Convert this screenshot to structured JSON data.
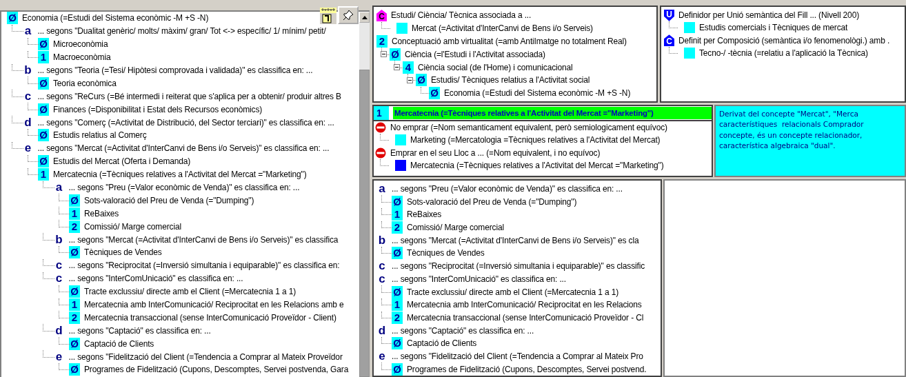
{
  "main_tree": {
    "nodes": [
      {
        "kind": "number",
        "badge": "Ø",
        "text": "Economia (=Estudi del Sistema econòmic -M +S -N)",
        "children": [
          {
            "kind": "letter",
            "badge": "a",
            "text": "... segons \"Dualitat genèric/ molts/ màxim/ gran/ Tot <-> específic/ 1/ mínim/ petit/",
            "children": [
              {
                "kind": "number",
                "badge": "Ø",
                "text": "Microeconòmia"
              },
              {
                "kind": "number",
                "badge": "1",
                "text": "Macroeconòmia"
              }
            ]
          },
          {
            "kind": "letter",
            "badge": "b",
            "text": "... segons \"Teoria (=Tesi/ Hipòtesi comprovada i validada)\" es classifica en: ...",
            "children": [
              {
                "kind": "number",
                "badge": "Ø",
                "text": "Teoria econòmica"
              }
            ]
          },
          {
            "kind": "letter",
            "badge": "c",
            "text": "... segons \"ReCurs (=Bé intermedi i reiterat que s'aplica per a obtenir/ produir altres B",
            "children": [
              {
                "kind": "number",
                "badge": "Ø",
                "text": "Finances (=Disponibilitat i Estat dels Recursos econòmics)"
              }
            ]
          },
          {
            "kind": "letter",
            "badge": "d",
            "text": "... segons \"Comerç (=Activitat de Distribució, del Sector terciari)\" es classifica en: ...",
            "children": [
              {
                "kind": "number",
                "badge": "Ø",
                "text": "Estudis relatius al Comerç"
              }
            ]
          },
          {
            "kind": "letter",
            "badge": "e",
            "text": "... segons \"Mercat (=Activitat d'InterCanvi de Bens i/o Serveis)\" es classifica en: ...",
            "children": [
              {
                "kind": "number",
                "badge": "Ø",
                "text": "Estudis del Mercat (Oferta i Demanda)"
              },
              {
                "kind": "number",
                "badge": "1",
                "text": "Mercatecnia (=Tècniques relatives a l'Activitat del Mercat =\"Marketing\")",
                "children": [
                  {
                    "kind": "letter",
                    "badge": "a",
                    "text": "... segons \"Preu (=Valor econòmic de Venda)\" es classifica en: ...",
                    "children": [
                      {
                        "kind": "number",
                        "badge": "Ø",
                        "text": "Sots-valoració del Preu de Venda (=\"Dumping\")"
                      },
                      {
                        "kind": "number",
                        "badge": "1",
                        "text": "ReBaixes"
                      },
                      {
                        "kind": "number",
                        "badge": "2",
                        "text": "Comissió/ Marge comercial"
                      }
                    ]
                  },
                  {
                    "kind": "letter",
                    "badge": "b",
                    "text": "... segons \"Mercat (=Activitat d'InterCanvi de Bens i/o Serveis)\" es classifica",
                    "children": [
                      {
                        "kind": "number",
                        "badge": "Ø",
                        "text": "Tècniques de Vendes"
                      }
                    ]
                  },
                  {
                    "kind": "letter",
                    "badge": "c",
                    "text": "... segons \"Reciprocitat (=Inversió simultania i equiparable)\" es classifica en:"
                  },
                  {
                    "kind": "letter",
                    "badge": "c",
                    "text": "... segons \"InterComUnicació\" es classifica en: ...",
                    "children": [
                      {
                        "kind": "number",
                        "badge": "Ø",
                        "text": "Tracte exclussiu/ directe amb el Client (=Mercatecnia 1 a 1)"
                      },
                      {
                        "kind": "number",
                        "badge": "1",
                        "text": "Mercatecnia amb InterComunicació/ Reciprocitat en les Relacions amb e"
                      },
                      {
                        "kind": "number",
                        "badge": "2",
                        "text": "Mercatecnia transaccional (sense InterComunicació Proveïdor - Client)"
                      }
                    ]
                  },
                  {
                    "kind": "letter",
                    "badge": "d",
                    "text": "... segons \"Captació\" es classifica en: ...",
                    "children": [
                      {
                        "kind": "number",
                        "badge": "Ø",
                        "text": "Captació de Clients"
                      }
                    ]
                  },
                  {
                    "kind": "letter",
                    "badge": "e",
                    "text": "... segons \"Fidelització del Client (=Tendencia a Comprar al Mateix Proveïdor",
                    "children": [
                      {
                        "kind": "number",
                        "badge": "Ø",
                        "text": "Programes de Fidelització (Cupons, Descomptes, Servei postvenda, Gara"
                      }
                    ]
                  }
                ]
              }
            ]
          }
        ]
      }
    ]
  },
  "relations_panel": {
    "nodes": [
      {
        "kind": "house",
        "badge": "C",
        "color": "#ff00ff",
        "text": "Estudi/ Ciència/ Tècnica associada a ...",
        "children": [
          {
            "kind": "square",
            "text": "Mercat (=Activitat d'InterCanvi de Bens i/o Serveis)"
          }
        ]
      },
      {
        "kind": "number",
        "badge": "2",
        "text": "Conceptuació amb virtualitat (=amb AntiImatge no totalment Real)",
        "children": [
          {
            "kind": "number",
            "badge": "Ø",
            "expanded": true,
            "text": "Ciència (=l'Estudi i l'Activitat associada)",
            "children": [
              {
                "kind": "number",
                "badge": "4",
                "expanded": true,
                "text": "Ciència social (de l'Home) i comunicacional",
                "children": [
                  {
                    "kind": "number",
                    "badge": "Ø",
                    "expanded": true,
                    "text": "Estudis/ Tècniques relatius a l'Activitat social",
                    "children": [
                      {
                        "kind": "number",
                        "badge": "Ø",
                        "text": "Economia (=Estudi del Sistema econòmic -M +S -N)"
                      }
                    ]
                  }
                ]
              }
            ]
          }
        ]
      }
    ]
  },
  "definitions_panel": {
    "nodes": [
      {
        "kind": "shield",
        "badge": "U",
        "color": "#0000ff",
        "text": "Definidor per Unió semàntica del Fill ... (Nivell 200)",
        "children": [
          {
            "kind": "square",
            "text": "Estudis comercials i Tècniques de mercat"
          }
        ]
      },
      {
        "kind": "house",
        "badge": "C",
        "color": "#0000ff",
        "text": "Definit per Composició (semàntica i/o fenomenològi.) amb .",
        "children": [
          {
            "kind": "square",
            "text": "Tecno-/ -tècnia (=relatiu a l'aplicació la Tècnica)"
          }
        ]
      }
    ]
  },
  "selected_concept": {
    "badge": "1",
    "title": "Mercatecnia (=Tècniques relatives a l'Activitat del Mercat =\"Marketing\")"
  },
  "synonyms": {
    "nodes": [
      {
        "kind": "no_entry",
        "text": "No emprar (=Nom semanticament equivalent, però semiologicament equívoc)",
        "children": [
          {
            "kind": "square",
            "color": "#00ffff",
            "text": "Marketing (=Mercatologia =Tècniques relatives a l'Activitat del Mercat)"
          }
        ]
      },
      {
        "kind": "no_entry",
        "text": "Emprar en el seu Lloc a ... (=Nom equivalent, i no equívoc)",
        "children": [
          {
            "kind": "square",
            "color": "#0000ff",
            "text": "Mercatecnia (=Tècniques relatives a l'Activitat del Mercat =\"Marketing\")"
          }
        ]
      }
    ]
  },
  "description": {
    "lines": [
      "Derivat del concepte \"Mercat\", \"Merca",
      "característiques  relacionals Comprador",
      "concepte, és un concepte relacionador, ",
      "característica algebraica \"dual\"."
    ]
  },
  "subtree": {
    "nodes": [
      {
        "kind": "letter",
        "badge": "a",
        "text": "... segons \"Preu (=Valor econòmic de Venda)\" es classifica en: ...",
        "children": [
          {
            "kind": "number",
            "badge": "Ø",
            "text": "Sots-valoració del Preu de Venda (=\"Dumping\")"
          },
          {
            "kind": "number",
            "badge": "1",
            "text": "ReBaixes"
          },
          {
            "kind": "number",
            "badge": "2",
            "text": "Comissió/ Marge comercial"
          }
        ]
      },
      {
        "kind": "letter",
        "badge": "b",
        "text": "... segons \"Mercat (=Activitat d'InterCanvi de Bens i/o Serveis)\" es cla",
        "children": [
          {
            "kind": "number",
            "badge": "Ø",
            "text": "Tècniques de Vendes"
          }
        ]
      },
      {
        "kind": "letter",
        "badge": "c",
        "text": "... segons \"Reciprocitat (=Inversió simultania i equiparable)\" es classific"
      },
      {
        "kind": "letter",
        "badge": "c",
        "text": "... segons \"InterComUnicació\" es classifica en: ...",
        "children": [
          {
            "kind": "number",
            "badge": "Ø",
            "text": "Tracte exclussiu/ directe amb el Client (=Mercatecnia 1 a 1)"
          },
          {
            "kind": "number",
            "badge": "1",
            "text": "Mercatecnia amb InterComunicació/ Reciprocitat en les Relacions"
          },
          {
            "kind": "number",
            "badge": "2",
            "text": "Mercatecnia transaccional (sense InterComunicació Proveïdor - Cl"
          }
        ]
      },
      {
        "kind": "letter",
        "badge": "d",
        "text": "... segons \"Captació\" es classifica en: ...",
        "children": [
          {
            "kind": "number",
            "badge": "Ø",
            "text": "Captació de Clients"
          }
        ]
      },
      {
        "kind": "letter",
        "badge": "e",
        "text": "... segons \"Fidelització del Client (=Tendencia a Comprar al Mateix Pro",
        "children": [
          {
            "kind": "number",
            "badge": "Ø",
            "text": "Programes de Fidelització (Cupons, Descomptes, Servei postvend."
          }
        ]
      }
    ]
  }
}
